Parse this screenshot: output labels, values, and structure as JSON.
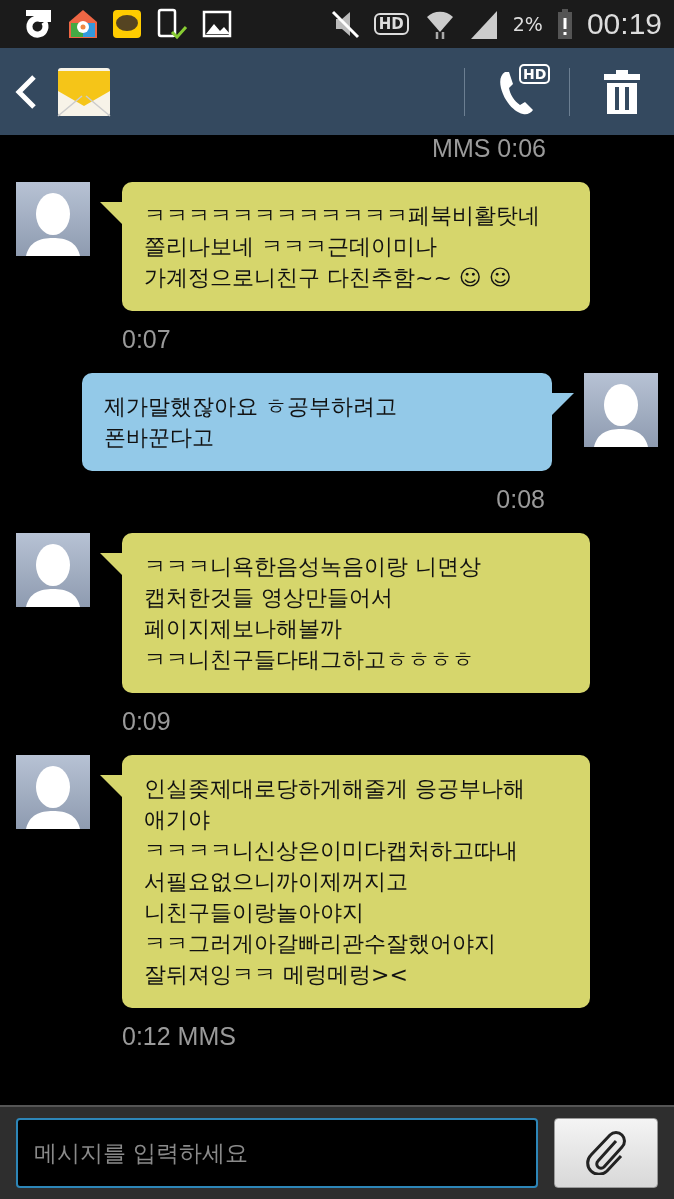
{
  "status_bar": {
    "hd_badge": "HD",
    "battery": "2%",
    "time": "00:19"
  },
  "header": {
    "call_badge": "HD"
  },
  "top_timestamp": "MMS 0:06",
  "messages": [
    {
      "kind": "incoming",
      "text": "ㅋㅋㅋㅋㅋㅋㅋㅋㅋㅋㅋㅋ페북비활탓네\n쫄리나보네 ㅋㅋㅋ근데이미나\n가계정으로니친구 다친추함~~ ☺ ☺",
      "time": "0:07"
    },
    {
      "kind": "outgoing",
      "text": "제가말했잖아요 ㅎ공부하려고\n폰바꾼다고",
      "time": "0:08"
    },
    {
      "kind": "incoming",
      "text": "ㅋㅋㅋ니욕한음성녹음이랑 니면상\n캡처한것들 영상만들어서\n페이지제보나해볼까\nㅋㅋ니친구들다태그하고ㅎㅎㅎㅎ",
      "time": "0:09"
    },
    {
      "kind": "incoming",
      "text": "인실좆제대로당하게해줄게 응공부나해\n애기야\nㅋㅋㅋㅋ니신상은이미다캡처하고따내\n서필요없으니까이제꺼지고\n니친구들이랑놀아야지\nㅋㅋ그러게아갈빠리관수잘했어야지\n잘뒤져잉ㅋㅋ 메렁메렁><\n",
      "time": "0:12 MMS"
    }
  ],
  "compose": {
    "placeholder": "메시지를 입력하세요"
  }
}
